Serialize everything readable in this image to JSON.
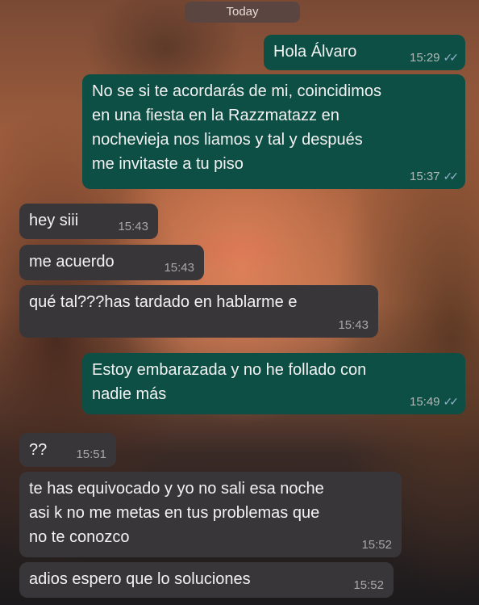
{
  "date_label": "Today",
  "messages": [
    {
      "dir": "out",
      "text": "Hola Álvaro",
      "time": "15:29",
      "status": "read"
    },
    {
      "dir": "out",
      "text": "No se si te acordarás de mi, coincidimos\nen una fiesta en la Razzmatazz en\nnochevieja nos liamos y tal y después\nme invitaste a tu piso",
      "time": "15:37",
      "status": "read"
    },
    {
      "dir": "in",
      "text": "hey siii",
      "time": "15:43"
    },
    {
      "dir": "in",
      "text": "me acuerdo",
      "time": "15:43"
    },
    {
      "dir": "in",
      "text": "qué tal???has tardado en hablarme e",
      "time": "15:43"
    },
    {
      "dir": "out",
      "text": "Estoy embarazada y no he follado con\nnadie más",
      "time": "15:49",
      "status": "read"
    },
    {
      "dir": "in",
      "text": "??",
      "time": "15:51"
    },
    {
      "dir": "in",
      "text": "te has equivocado y yo no sali esa noche\nasi k no me metas en tus problemas que\nno te conozco",
      "time": "15:52"
    },
    {
      "dir": "in",
      "text": "adios espero que lo soluciones",
      "time": "15:52"
    }
  ],
  "icons": {
    "read_receipt": "double-check-icon"
  },
  "colors": {
    "outgoing_bubble": "#0e4f45",
    "incoming_bubble": "#393639",
    "read_tick": "#8fb2c8"
  }
}
